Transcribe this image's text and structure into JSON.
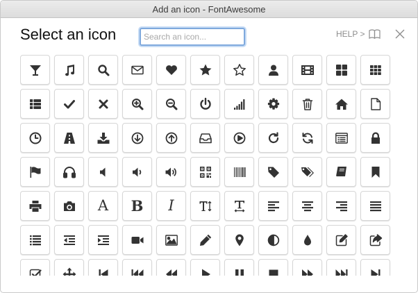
{
  "window": {
    "title": "Add an icon - FontAwesome"
  },
  "header": {
    "title": "Select an icon",
    "search_placeholder": "Search an icon...",
    "help_label": "HELP >"
  },
  "icons": [
    "glass-icon",
    "music-icon",
    "search-icon",
    "envelope-icon",
    "heart-icon",
    "star-icon",
    "star-outline-icon",
    "user-icon",
    "film-icon",
    "th-large-icon",
    "th-icon",
    "th-list-icon",
    "check-icon",
    "times-icon",
    "zoom-in-icon",
    "zoom-out-icon",
    "power-off-icon",
    "signal-icon",
    "cog-icon",
    "trash-icon",
    "home-icon",
    "file-icon",
    "clock-icon",
    "road-icon",
    "download-icon",
    "arrow-circle-down-icon",
    "arrow-circle-up-icon",
    "inbox-icon",
    "play-circle-icon",
    "repeat-icon",
    "refresh-icon",
    "list-alt-icon",
    "lock-icon",
    "flag-icon",
    "headphones-icon",
    "volume-off-icon",
    "volume-down-icon",
    "volume-up-icon",
    "qrcode-icon",
    "barcode-icon",
    "tag-icon",
    "tags-icon",
    "book-icon",
    "bookmark-icon",
    "print-icon",
    "camera-icon",
    "font-icon",
    "bold-icon",
    "italic-icon",
    "text-height-icon",
    "text-width-icon",
    "align-left-icon",
    "align-center-icon",
    "align-right-icon",
    "align-justify-icon",
    "list-icon",
    "outdent-icon",
    "indent-icon",
    "video-camera-icon",
    "picture-icon",
    "pencil-icon",
    "map-marker-icon",
    "adjust-icon",
    "tint-icon",
    "edit-icon",
    "share-icon",
    "check-square-icon",
    "arrows-icon",
    "step-backward-icon",
    "fast-backward-icon",
    "backward-icon",
    "play-icon",
    "pause-icon",
    "stop-icon",
    "forward-icon",
    "fast-forward-icon",
    "step-forward-icon"
  ],
  "glyph_text": {
    "font": "A",
    "bold": "B",
    "italic": "I"
  },
  "colors": {
    "icon": "#333333",
    "focus": "#7fa9dd"
  }
}
